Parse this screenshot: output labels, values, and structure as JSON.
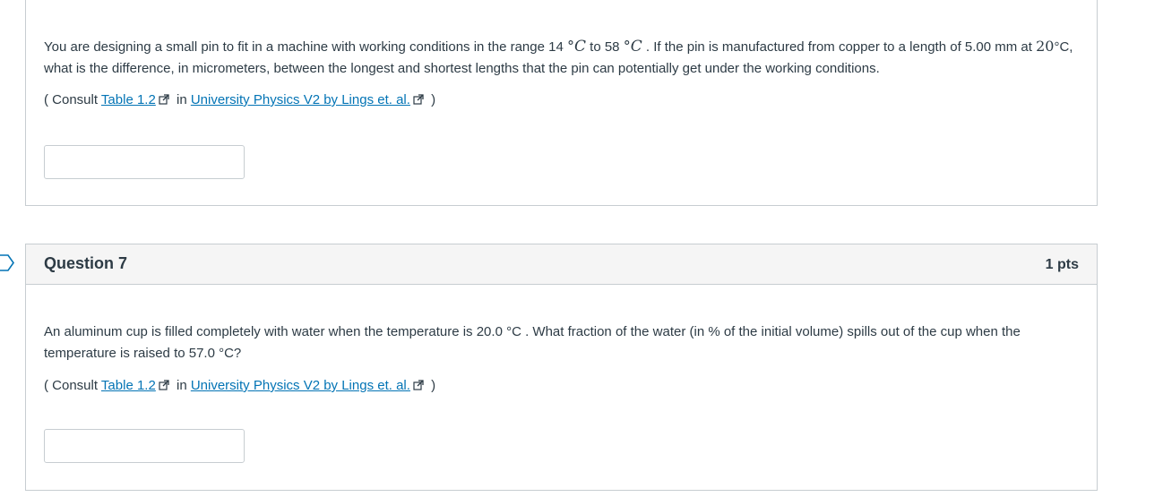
{
  "question6": {
    "text_part1": "You are designing a small pin to fit in a machine with working conditions in the range 14 ",
    "deg_symbol": "°",
    "unit_c": "C",
    "text_part2": " to 58 ",
    "text_part3": " . If the pin is manufactured from copper to a length of 5.00 mm at ",
    "temp_20": "20",
    "text_part4": "C, what is the difference, in micrometers, between the longest and shortest lengths that the pin can potentially get under the working conditions.",
    "consult_prefix": "( Consult ",
    "table_link": "Table 1.2",
    "consult_in": " in ",
    "book_link": "University Physics V2 by Lings et. al.",
    "consult_suffix": " )",
    "answer_value": ""
  },
  "question7": {
    "title": "Question 7",
    "points": "1 pts",
    "text": "An aluminum cup is filled completely with water when the temperature is 20.0 °C . What fraction of the water (in % of the initial volume) spills out of the cup when the temperature is raised to 57.0 °C?",
    "consult_prefix": "( Consult ",
    "table_link": "Table 1.2",
    "consult_in": " in ",
    "book_link": "University Physics V2 by Lings et. al.",
    "consult_suffix": " )",
    "answer_value": ""
  },
  "colors": {
    "link": "#0374b5",
    "text": "#2d3b45",
    "border": "#c7cdd1",
    "header_bg": "#f5f5f5"
  },
  "icons": [
    "external-link-icon",
    "bookmark-flag-icon"
  ]
}
